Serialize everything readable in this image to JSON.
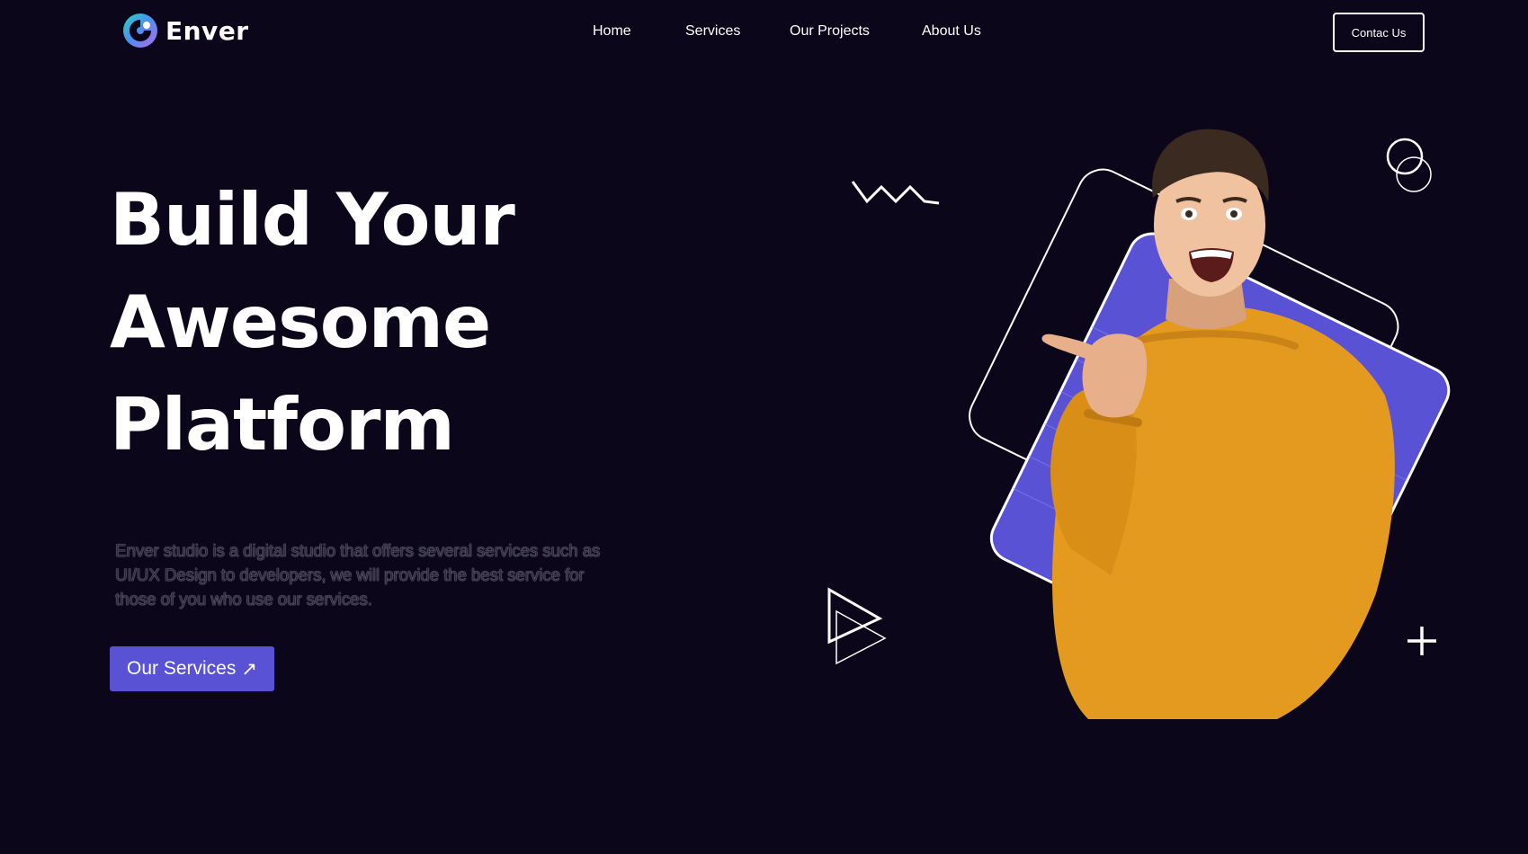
{
  "brand": {
    "name": "Enver",
    "logo_icon": "brand-logo-icon"
  },
  "nav": {
    "items": [
      {
        "label": "Home"
      },
      {
        "label": "Services"
      },
      {
        "label": "Our Projects"
      },
      {
        "label": "About Us"
      }
    ],
    "contact_label": "Contac Us"
  },
  "hero": {
    "title_lines": [
      "Build Your",
      "Awesome",
      "Platform"
    ],
    "description": "Enver studio is a digital studio that offers several services such as UI/UX Design to developers, we will provide the best service for those of you who use our services.",
    "cta_label": "Our Services",
    "cta_icon": "↗"
  },
  "colors": {
    "background": "#0b0619",
    "accent": "#5a52d5",
    "sweater": "#e49a1f",
    "text": "#ffffff"
  }
}
